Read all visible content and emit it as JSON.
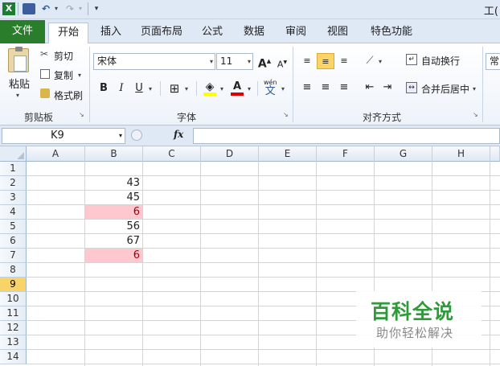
{
  "title_partial": "工(",
  "tabs": [
    "文件",
    "开始",
    "插入",
    "页面布局",
    "公式",
    "数据",
    "审阅",
    "视图",
    "特色功能"
  ],
  "ribbon": {
    "clipboard": {
      "paste": "粘贴",
      "cut": "剪切",
      "copy": "复制",
      "format_painter": "格式刷",
      "label": "剪贴板"
    },
    "font": {
      "name": "宋体",
      "size": "11",
      "bold": "B",
      "italic": "I",
      "underline": "U",
      "grow": "A",
      "shrink": "A",
      "font_color": "A",
      "phonetic": "wén",
      "phonetic_char": "文",
      "label": "字体"
    },
    "alignment": {
      "wrap_text": "自动换行",
      "merge_center": "合并后居中",
      "label": "对齐方式"
    },
    "number": {
      "format_partial": "常"
    }
  },
  "formula_bar": {
    "name_box": "K9",
    "fx": "fx"
  },
  "columns": [
    "A",
    "B",
    "C",
    "D",
    "E",
    "F",
    "G",
    "H"
  ],
  "rows": [
    "1",
    "2",
    "3",
    "4",
    "5",
    "6",
    "7",
    "8",
    "9",
    "10",
    "11",
    "12",
    "13",
    "14"
  ],
  "selected_row": "9",
  "cells_b": [
    "",
    "43",
    "45",
    "6",
    "56",
    "67",
    "6",
    "",
    "",
    "",
    "",
    "",
    "",
    ""
  ],
  "highlight_rows": [
    4,
    7
  ],
  "colors": {
    "file_tab": "#2a7d2a",
    "highlight_fill": "#ffc7ce",
    "highlight_text": "#9c0006",
    "selected_row_header": "#f8d468",
    "watermark_green": "#2e9a3a"
  },
  "watermark": {
    "title": "百科全说",
    "subtitle": "助你轻松解决"
  }
}
